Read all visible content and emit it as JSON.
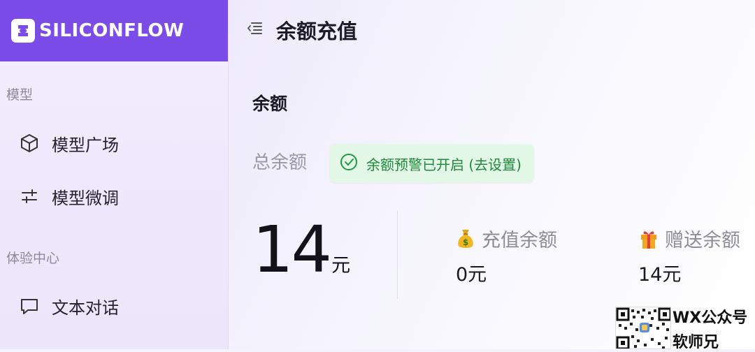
{
  "brand": {
    "name": "SILICONFLOW"
  },
  "sidebar": {
    "groups": [
      {
        "label": "模型",
        "items": [
          {
            "label": "模型广场",
            "icon": "cube-icon"
          },
          {
            "label": "模型微调",
            "icon": "sliders-icon"
          }
        ]
      },
      {
        "label": "体验中心",
        "items": [
          {
            "label": "文本对话",
            "icon": "chat-bubble-icon"
          }
        ]
      }
    ]
  },
  "header": {
    "title": "余额充值",
    "menu_icon": "collapse-menu-icon"
  },
  "balance": {
    "section_title": "余额",
    "total_label": "总余额",
    "alert_text": "余额预警已开启 (去设置)",
    "total_value": "14",
    "total_unit": "元",
    "recharge_label": "充值余额",
    "recharge_value": "0元",
    "gift_label": "赠送余额",
    "gift_value": "14元"
  },
  "watermark": {
    "line1": "WX公众号",
    "line2": "软师兄"
  },
  "colors": {
    "brand": "#7b4ce8",
    "alert_bg": "#e3f8e6",
    "alert_text": "#1c8a3a"
  }
}
